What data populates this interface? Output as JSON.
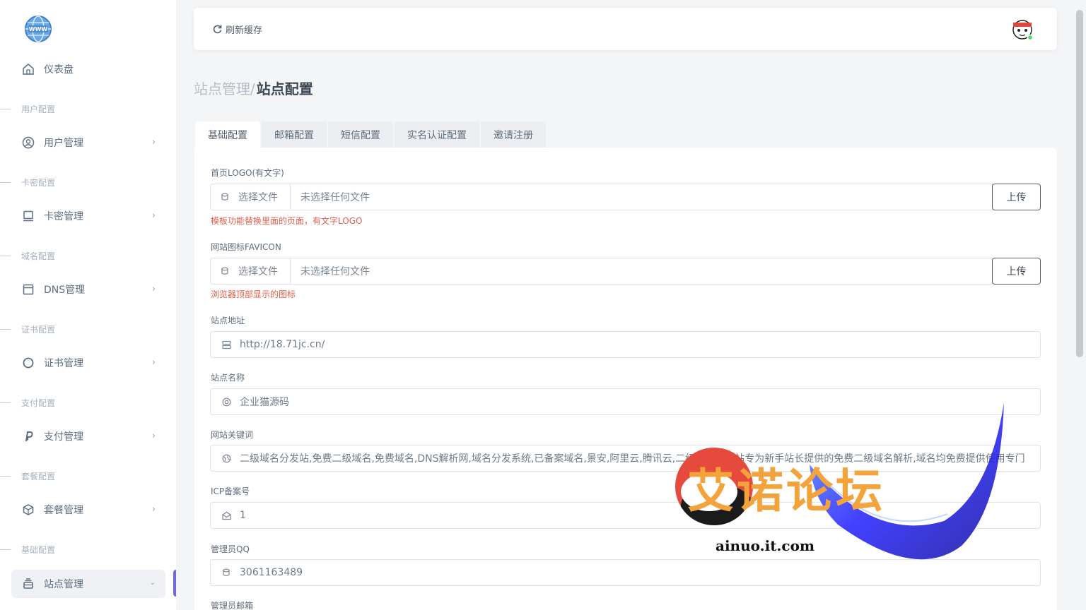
{
  "sidebar": {
    "items": [
      {
        "label": "仪表盘",
        "icon": "home-icon"
      },
      {
        "section": "用户配置"
      },
      {
        "label": "用户管理",
        "icon": "user-circle-icon"
      },
      {
        "section": "卡密配置"
      },
      {
        "label": "卡密管理",
        "icon": "monitor-icon"
      },
      {
        "section": "域名配置"
      },
      {
        "label": "DNS管理",
        "icon": "browser-window-icon"
      },
      {
        "section": "证书配置"
      },
      {
        "label": "证书管理",
        "icon": "circle-icon"
      },
      {
        "section": "支付配置"
      },
      {
        "label": "支付管理",
        "icon": "paypal-icon"
      },
      {
        "section": "套餐配置"
      },
      {
        "label": "套餐管理",
        "icon": "package-icon"
      },
      {
        "section": "基础配置"
      },
      {
        "label": "站点管理",
        "icon": "tray-icon",
        "active": true
      }
    ]
  },
  "topbar": {
    "refresh_label": "刷新缓存"
  },
  "breadcrumb": {
    "parent": "站点管理/",
    "current": "站点配置"
  },
  "tabs": [
    "基础配置",
    "邮箱配置",
    "短信配置",
    "实名认证配置",
    "邀请注册"
  ],
  "form": {
    "logo": {
      "label": "首页LOGO(有文字)",
      "choose": "选择文件",
      "filename": "未选择任何文件",
      "upload": "上传",
      "hint": "模板功能替换里面的页面，有文字LOGO"
    },
    "favicon": {
      "label": "网站图标FAVICON",
      "choose": "选择文件",
      "filename": "未选择任何文件",
      "upload": "上传",
      "hint": "浏览器顶部显示的图标"
    },
    "site_url": {
      "label": "站点地址",
      "value": "http://18.71jc.cn/"
    },
    "site_name": {
      "label": "站点名称",
      "value": "企业猫源码"
    },
    "keywords": {
      "label": "网站关键词",
      "value": "二级域名分发站,免费二级域名,免费域名,DNS解析网,域名分发系统,已备案域名,景安,阿里云,腾讯云,二级域名分发站专为新手站长提供的免费二级域名解析,域名均免费提供使用专门"
    },
    "icp": {
      "label": "ICP备案号",
      "value": "1"
    },
    "admin_qq": {
      "label": "管理员QQ",
      "value": "3061163489"
    },
    "admin_email": {
      "label": "管理员邮箱"
    }
  },
  "watermark": {
    "text": "艾诺论坛",
    "url": "ainuo.it.com"
  },
  "colors": {
    "accent": "#7367f0",
    "hint": "#e35d4b",
    "watermark_orange": "#f3a33a"
  }
}
